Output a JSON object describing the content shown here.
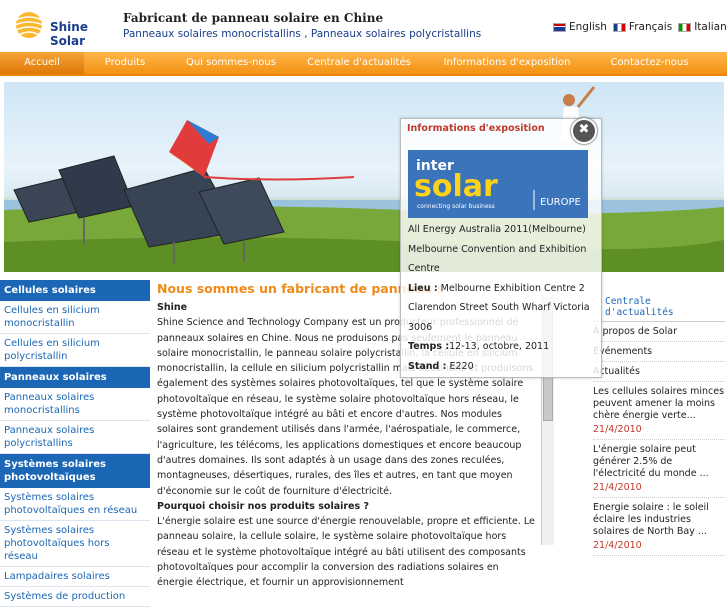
{
  "header": {
    "logo_text": "Shine Solar",
    "title": "Fabricant de panneau solaire en Chine",
    "subtitle": "Panneaux solaires monocristallins , Panneaux solaires polycristallins",
    "languages": [
      "English",
      "Français",
      "Italiano"
    ]
  },
  "nav": [
    "Accueil",
    "Produits",
    "Qui sommes-nous",
    "Centrale d'actualités",
    "Informations d'exposition",
    "Contactez-nous"
  ],
  "sidebar": {
    "sections": [
      {
        "title": "Cellules solaires",
        "items": [
          "Cellules en silicium monocristallin",
          "Cellules en silicium polycristallin"
        ]
      },
      {
        "title": "Panneaux solaires",
        "items": [
          "Panneaux solaires monocristallins",
          "Panneaux solaires polycristallins"
        ]
      },
      {
        "title": "Systèmes solaires photovoltaïques",
        "items": [
          "Systèmes solaires photovoltaïques en réseau",
          "Systèmes solaires photovoltaïques hors réseau",
          "Lampadaires solaires",
          "Systèmes de production"
        ]
      }
    ]
  },
  "main": {
    "title": "Nous sommes un fabricant de panneau s",
    "company": "Shine",
    "p1": "Shine Science and Technology Company est un producteur professionnel de panneaux solaires en Chine. Nous ne produisons pas seulement le panneau solaire monocristallin, le panneau solaire polycristallin, la cellule en silicium monocristallin, la cellule en silicium polycristallin mais dessinons et produisons également des systèmes solaires photovoltaïques, tel que le système solaire photovoltaïque en réseau, le système solaire photovoltaïque hors réseau, le système photovoltaïque intégré au bâti et encore d'autres. Nos modules solaires sont grandement utilisés dans l'armée, l'aérospatiale, le commerce, l'agriculture, les télécoms, les applications domestiques et encore beaucoup d'autres domaines. Ils sont adaptés à un usage dans des zones reculées, montagneuses, désertiques, rurales, des îles et autres, en tant que moyen d'économie sur le coût de fourniture d'électricité.",
    "q2": "Pourquoi choisir nos produits solaires ?",
    "p2": "L'énergie solaire est une source d'énergie renouvelable, propre et efficiente. Le panneau solaire, la cellule solaire, le système solaire photovoltaïque hors réseau et le système photovoltaïque intégré au bâti utilisent des composants photovoltaïques pour accomplir la conversion des radiations solaires en énergie électrique, et fournir un approvisionnement"
  },
  "right": {
    "heading": "Centrale d'actualités",
    "links": [
      "À propos de Solar",
      "Événements",
      "Actualités"
    ],
    "news": [
      {
        "title": "Les cellules solaires minces peuvent amener la moins chère énergie verte...",
        "date": "21/4/2010"
      },
      {
        "title": "L'énergie solaire peut générer 2.5% de l'électricité du monde ...",
        "date": "21/4/2010"
      },
      {
        "title": "Energie solaire : le soleil éclaire les industries solaires de North Bay ...",
        "date": "21/4/2010"
      }
    ]
  },
  "popup": {
    "title": "Informations d'exposition",
    "logo_line1": "inter",
    "logo_line2": "solar",
    "logo_tag": "connecting solar business",
    "logo_region": "EUROPE",
    "event": "All Energy Australia 2011(Melbourne)",
    "venue": "Melbourne Convention and Exhibition Centre",
    "lieu_label": "Lieu :",
    "lieu": "Melbourne Exhibition Centre 2 Clarendon Street South Wharf Victoria 3006",
    "temps_label": "Temps :",
    "temps": "12-13, octobre, 2011",
    "stand_label": "Stand :",
    "stand": "E220",
    "close_glyph": "✖"
  }
}
